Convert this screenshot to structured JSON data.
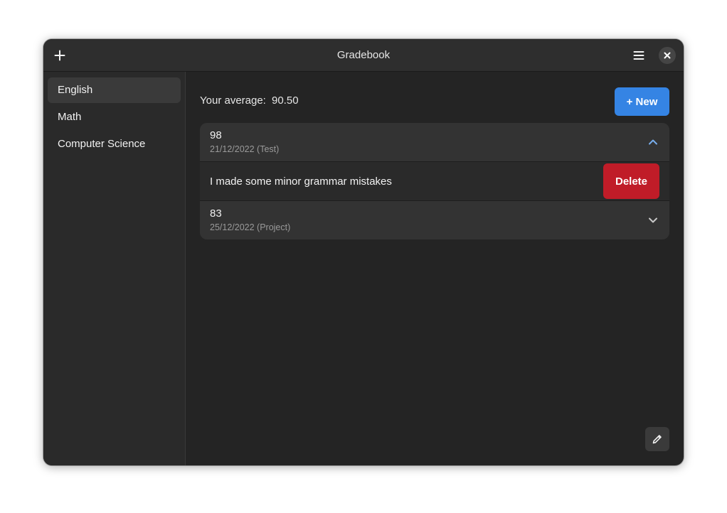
{
  "header": {
    "title": "Gradebook",
    "add_icon": "plus-icon",
    "menu_icon": "hamburger-menu-icon",
    "close_icon": "close-icon"
  },
  "sidebar": {
    "items": [
      {
        "label": "English",
        "selected": true
      },
      {
        "label": "Math",
        "selected": false
      },
      {
        "label": "Computer Science",
        "selected": false
      }
    ]
  },
  "main": {
    "average_label": "Your average:",
    "average_value": "90.50",
    "new_button_label": "+ New",
    "grades": [
      {
        "score": "98",
        "subtitle": "21/12/2022 (Test)",
        "expanded": true,
        "note": "I made some minor grammar mistakes",
        "delete_label": "Delete"
      },
      {
        "score": "83",
        "subtitle": "25/12/2022 (Project)",
        "expanded": false
      }
    ],
    "edit_icon": "pencil-icon"
  },
  "colors": {
    "accent": "#3584e4",
    "destructive": "#c01c28",
    "window_bg": "#242424",
    "sidebar_bg": "#2a2a2a"
  }
}
